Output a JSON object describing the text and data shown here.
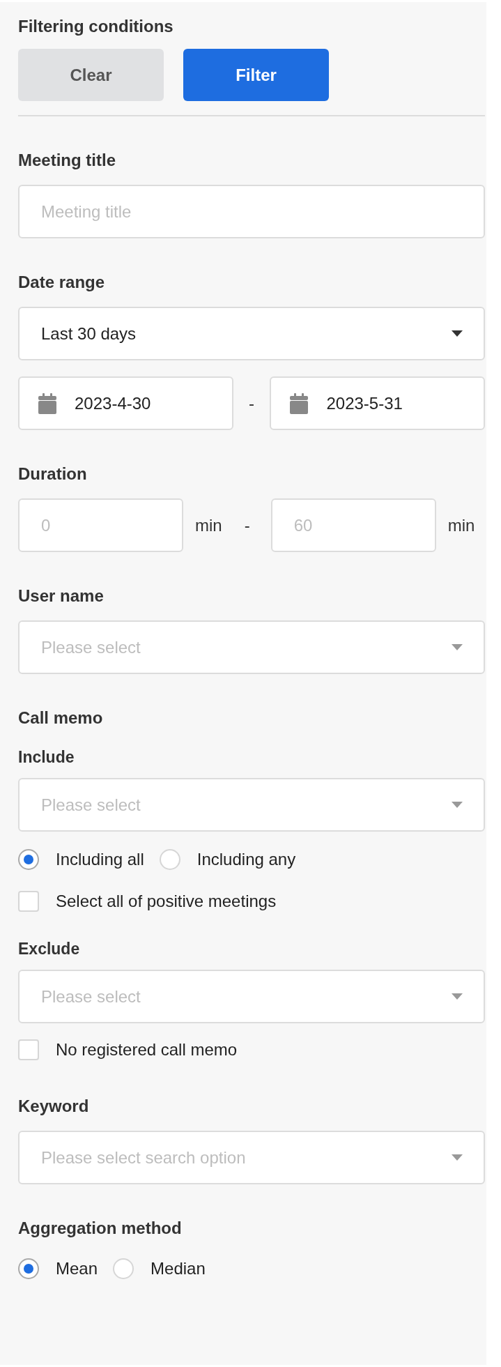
{
  "header": {
    "title": "Filtering conditions"
  },
  "buttons": [
    {
      "label": "Clear",
      "kind": "secondary"
    },
    {
      "label": "Filter",
      "kind": "primary"
    }
  ],
  "sections": [
    {
      "label": "Meeting title",
      "fields": [
        {
          "kind": "text",
          "placeholder": "Meeting title"
        }
      ]
    },
    {
      "label": "Date range",
      "fields": [
        {
          "kind": "select",
          "value": "Last 30 days"
        },
        {
          "kind": "date_range",
          "from": "2023-4-30",
          "separator": "-",
          "to": "2023-5-31"
        }
      ]
    },
    {
      "label": "Duration",
      "fields": [
        {
          "kind": "number_range",
          "min_placeholder": "0",
          "min_unit": "min",
          "separator": "-",
          "max_placeholder": "60",
          "max_unit": "min"
        }
      ]
    },
    {
      "label": "User name",
      "fields": [
        {
          "kind": "select",
          "placeholder": "Please select"
        }
      ]
    },
    {
      "label": "Call memo",
      "fields": [
        {
          "kind": "sublabel",
          "label": "Include"
        },
        {
          "kind": "select",
          "placeholder": "Please select"
        },
        {
          "kind": "radios",
          "options": [
            {
              "label": "Including all",
              "selected": true
            },
            {
              "label": "Including any",
              "selected": false
            }
          ]
        },
        {
          "kind": "checkbox",
          "label": "Select all of positive meetings",
          "checked": false
        },
        {
          "kind": "sublabel",
          "label": "Exclude"
        },
        {
          "kind": "select",
          "placeholder": "Please select"
        },
        {
          "kind": "checkbox",
          "label": "No registered call memo",
          "checked": false
        }
      ]
    },
    {
      "label": "Keyword",
      "fields": [
        {
          "kind": "select",
          "placeholder": "Please select search option"
        }
      ]
    },
    {
      "label": "Aggregation method",
      "fields": [
        {
          "kind": "radios",
          "options": [
            {
              "label": "Mean",
              "selected": true
            },
            {
              "label": "Median",
              "selected": false
            }
          ]
        }
      ]
    }
  ]
}
